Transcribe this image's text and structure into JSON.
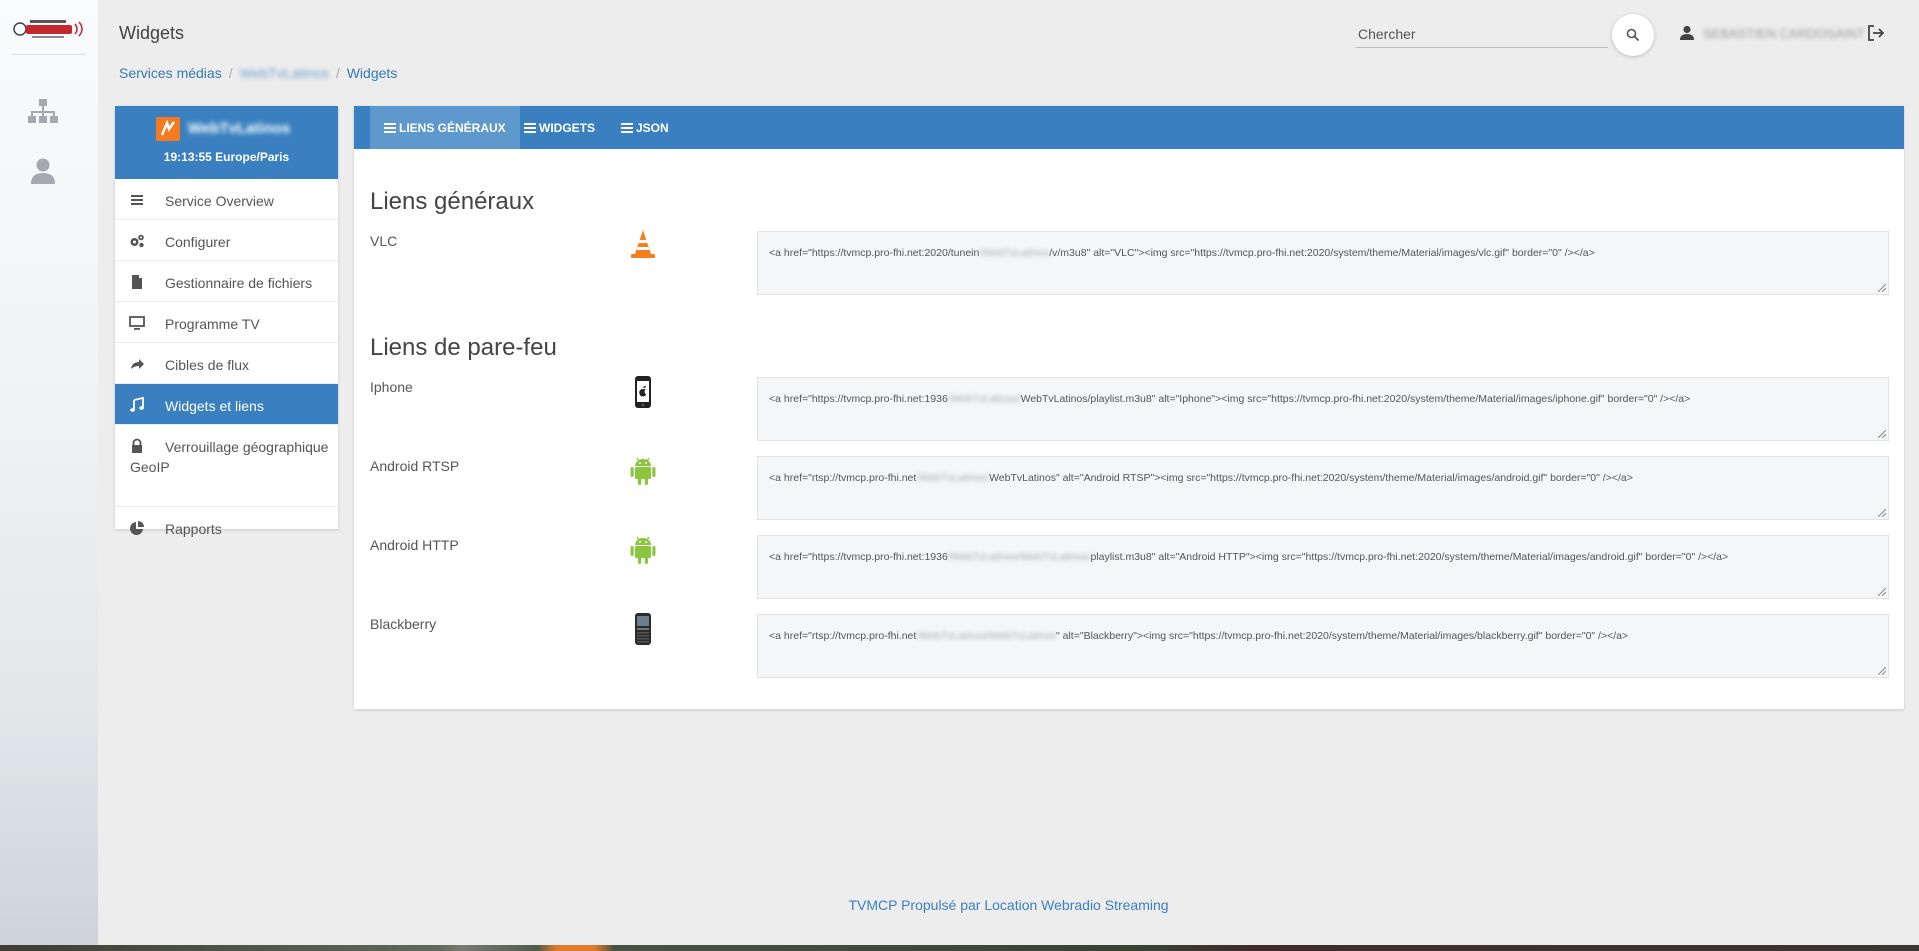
{
  "header": {
    "title": "Widgets",
    "search_placeholder": "Chercher",
    "user_name": "SEBASTIEN CARDOSAINT"
  },
  "breadcrumb": {
    "root": "Services médias",
    "middle": "WebTvLatinos",
    "current": "Widgets"
  },
  "station": {
    "name": "WebTvLatinos",
    "time": "19:13:55 Europe/Paris"
  },
  "menu": {
    "items": [
      {
        "label": "Service Overview",
        "icon": "list-icon"
      },
      {
        "label": "Configurer",
        "icon": "gears-icon"
      },
      {
        "label": "Gestionnaire de fichiers",
        "icon": "file-icon"
      },
      {
        "label": "Programme TV",
        "icon": "monitor-icon"
      },
      {
        "label": "Cibles de flux",
        "icon": "share-arrow-icon"
      },
      {
        "label": "Widgets et liens",
        "icon": "music-note-icon"
      },
      {
        "label": "Verrouillage géographique GeoIP",
        "icon": "lock-icon"
      },
      {
        "label": "Rapports",
        "icon": "pie-chart-icon"
      }
    ]
  },
  "tabs": [
    {
      "label": "LIENS GÉNÉRAUX"
    },
    {
      "label": "WIDGETS"
    },
    {
      "label": "JSON"
    }
  ],
  "sections": {
    "general": "Liens généraux",
    "firewall": "Liens de pare-feu"
  },
  "links": {
    "vlc": {
      "label": "VLC",
      "code_a": "<a href=\"https://tvmcp.pro-fhi.net:2020/tunein",
      "code_b": "/WebTvLatinos",
      "code_c": "/v/m3u8\" alt=\"VLC\"><img src=\"https://tvmcp.pro-fhi.net:2020/system/theme/Material/images/vlc.gif\" border=\"0\" /></a>"
    },
    "iphone": {
      "label": "Iphone",
      "code_a": "<a href=\"https://tvmcp.pro-fhi.net:1936",
      "code_b": "/WebTvLatinos/",
      "code_c": "WebTvLatinos/playlist.m3u8\" alt=\"Iphone\"><img src=\"https://tvmcp.pro-fhi.net:2020/system/theme/Material/images/iphone.gif\" border=\"0\" /></a>"
    },
    "android_rtsp": {
      "label": "Android RTSP",
      "code_a": "<a href=\"rtsp://tvmcp.pro-fhi.net",
      "code_b": "/WebTvLatinos/",
      "code_c": "WebTvLatinos\" alt=\"Android RTSP\"><img src=\"https://tvmcp.pro-fhi.net:2020/system/theme/Material/images/android.gif\" border=\"0\" /></a>"
    },
    "android_http": {
      "label": "Android HTTP",
      "code_a": "<a href=\"https://tvmcp.pro-fhi.net:1936",
      "code_b": "/WebTvLatinos/WebTvLatinos/",
      "code_c": "playlist.m3u8\" alt=\"Android HTTP\"><img src=\"https://tvmcp.pro-fhi.net:2020/system/theme/Material/images/android.gif\" border=\"0\" /></a>"
    },
    "blackberry": {
      "label": "Blackberry",
      "code_a": "<a href=\"rtsp://tvmcp.pro-fhi.net",
      "code_b": "/WebTvLatinos/WebTvLatinos",
      "code_c": "\" alt=\"Blackberry\"><img src=\"https://tvmcp.pro-fhi.net:2020/system/theme/Material/images/blackberry.gif\" border=\"0\" /></a>"
    }
  },
  "footer": "TVMCP Propulsé par Location Webradio Streaming",
  "colors": {
    "primary": "#3a80c1",
    "tab_active": "#5e98cd",
    "vlc_orange": "#f48120",
    "android_green": "#8cc63f"
  }
}
